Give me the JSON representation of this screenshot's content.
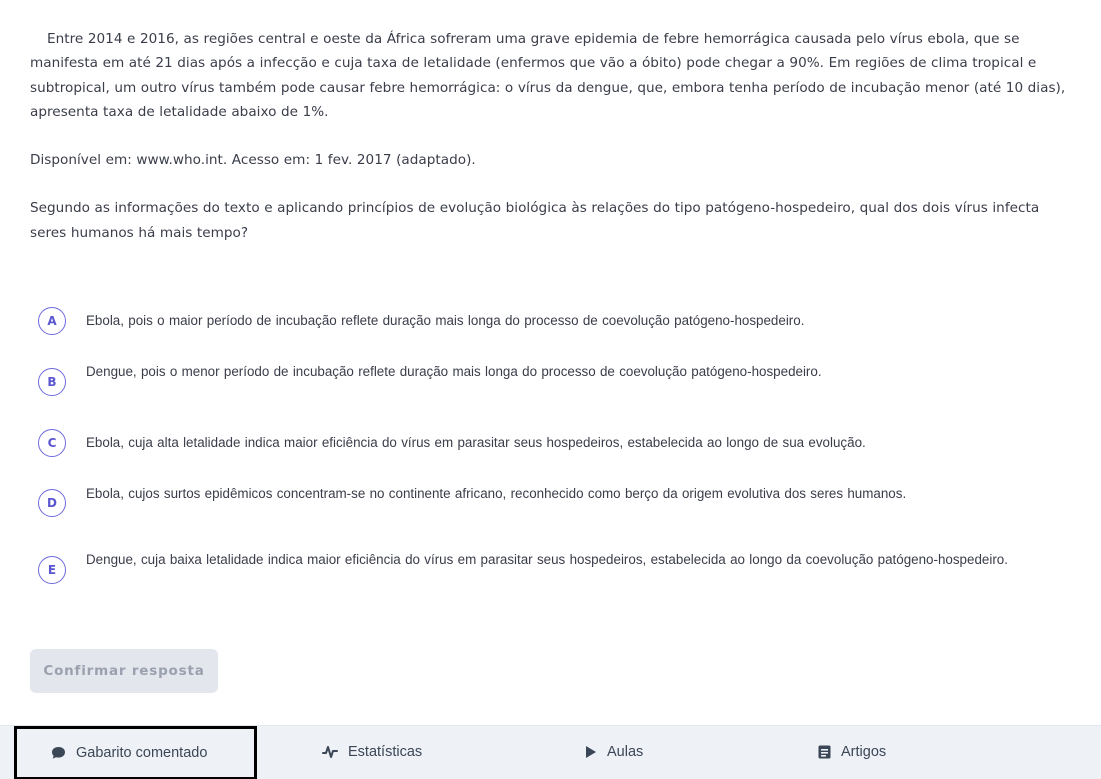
{
  "question": {
    "stem": "Entre 2014 e 2016, as regiões central e oeste da África sofreram uma grave epidemia de febre hemorrágica causada pelo vírus ebola, que se manifesta em até 21 dias após a infecção e cuja taxa de letalidade (enfermos que vão a óbito) pode chegar a 90%. Em regiões de clima tropical e subtropical, um outro vírus também pode causar febre hemorrágica: o vírus da dengue, que, embora tenha período de incubação menor (até 10 dias), apresenta taxa de letalidade abaixo de 1%.",
    "source": "Disponível em: www.who.int. Acesso em: 1 fev. 2017 (adaptado).",
    "prompt": "Segundo as informações do texto e aplicando princípios de evolução biológica às relações do tipo patógeno-hospedeiro, qual dos dois vírus infecta seres humanos há mais tempo?"
  },
  "alternatives": [
    {
      "letter": "A",
      "text": "Ebola, pois o maior período de incubação reflete duração mais longa do processo de coevolução patógeno-hospedeiro."
    },
    {
      "letter": "B",
      "text": "Dengue, pois o menor período de incubação reflete duração mais longa do processo de coevolução patógeno-hospedeiro."
    },
    {
      "letter": "C",
      "text": "Ebola, cuja alta letalidade indica maior eficiência do vírus em parasitar seus hospedeiros, estabelecida ao longo de sua evolução."
    },
    {
      "letter": "D",
      "text": "Ebola, cujos surtos epidêmicos concentram-se no continente africano, reconhecido como berço da origem evolutiva dos seres humanos."
    },
    {
      "letter": "E",
      "text": "Dengue, cuja baixa letalidade indica maior eficiência do vírus em parasitar seus hospedeiros, estabelecida ao longo da coevolução patógeno-hospedeiro."
    }
  ],
  "confirm_button": {
    "label": "Confirmar resposta",
    "disabled": true
  },
  "tabs": [
    {
      "label": "Gabarito comentado",
      "icon": "chat-bubble-icon",
      "selected": true
    },
    {
      "label": "Estatísticas",
      "icon": "pulse-icon"
    },
    {
      "label": "Aulas",
      "icon": "play-icon"
    },
    {
      "label": "Artigos",
      "icon": "article-icon"
    }
  ],
  "colors": {
    "accent": "#6f6ae0",
    "text": "#3a3d4a",
    "button_disabled_bg": "#e3e6ec",
    "button_disabled_text": "#9aa0ad",
    "tabbar_bg": "#eef1f5",
    "focus_outline": "#000000"
  }
}
